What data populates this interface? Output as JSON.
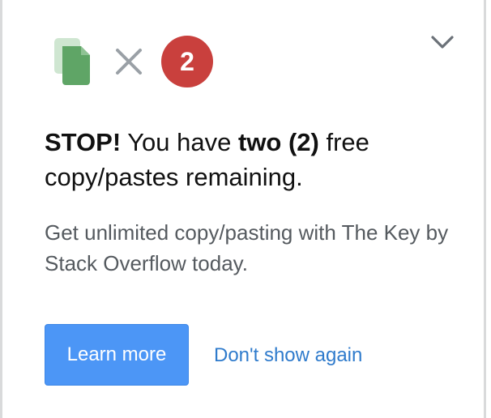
{
  "header": {
    "copy_icon": "copy-icon",
    "times_icon": "times-icon",
    "count_badge": "2",
    "collapse_icon": "chevron-down-icon"
  },
  "message": {
    "stop": "STOP!",
    "text_before": " You have ",
    "bold_count": "two (2)",
    "text_after": " free copy/pastes remaining.",
    "subtext": "Get unlimited copy/pasting with The Key by Stack Overflow today."
  },
  "actions": {
    "learn_more_label": "Learn more",
    "dont_show_label": "Don't show again"
  },
  "colors": {
    "icon_green": "#5fa566",
    "icon_green_light": "#cfe6d1",
    "badge_red": "#c9403d",
    "button_blue": "#4c96f6",
    "link_blue": "#2f7bcc"
  }
}
